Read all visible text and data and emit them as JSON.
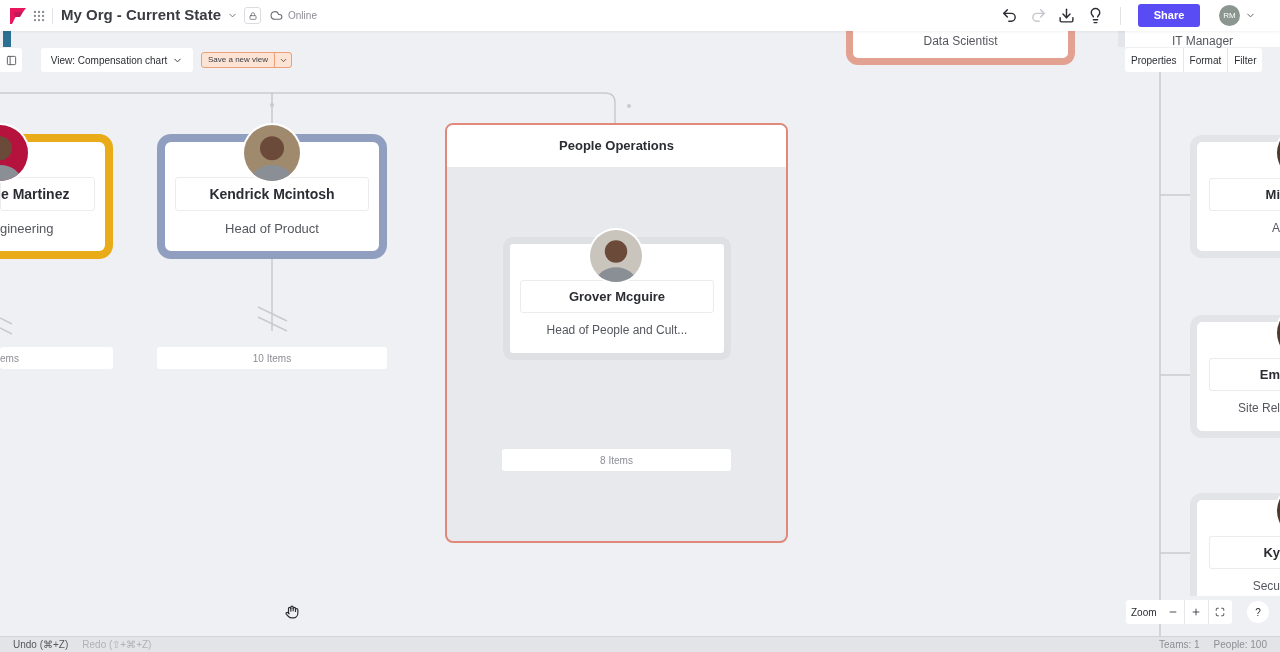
{
  "header": {
    "title": "My Org - Current State",
    "status": "Online",
    "share": "Share",
    "avatar_initials": "RM"
  },
  "toolbar": {
    "view": "View: Compensation chart",
    "save_view": "Save a new view"
  },
  "panel_tabs": [
    "Properties",
    "Format",
    "Filter"
  ],
  "top_cards": [
    {
      "role": "Data Scientist",
      "color": "#e3a191"
    },
    {
      "role": "IT Manager",
      "color": "#e4e5ea"
    }
  ],
  "people": [
    {
      "name": "e Martinez",
      "role": "gineering",
      "color": "#e9ab18",
      "items": "ems"
    },
    {
      "name": "Kendrick Mcintosh",
      "role": "Head of Product",
      "color": "#909ebf",
      "items": "10 Items"
    }
  ],
  "team": {
    "title": "People Operations",
    "member": {
      "name": "Grover Mcguire",
      "role": "Head of People and Cult...",
      "items": "8 Items"
    }
  },
  "right_cards": [
    {
      "name": "Mi",
      "role": "A"
    },
    {
      "name": "Em",
      "role": "Site Rel"
    },
    {
      "name": "Ky",
      "role": "Secu"
    }
  ],
  "zoom": {
    "label": "Zoom",
    "help": "?"
  },
  "status_bar": {
    "undo": "Undo (⌘+Z)",
    "redo": "Redo (⇧+⌘+Z)",
    "teams": "Teams: 1",
    "people": "People: 100"
  }
}
